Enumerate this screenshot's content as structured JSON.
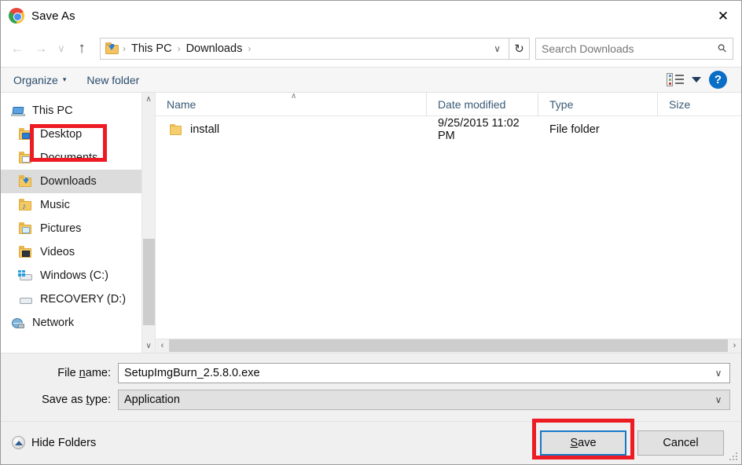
{
  "window": {
    "title": "Save As",
    "app_icon": "chrome-icon",
    "close_label": "✕"
  },
  "nav": {
    "back": "←",
    "forward": "→",
    "recent": "∨",
    "up": "↑",
    "address": {
      "folder_icon": "downloads-folder-icon",
      "crumbs": [
        "This PC",
        "Downloads"
      ],
      "separator": "›",
      "chevron": "∨"
    },
    "refresh": "↻",
    "search": {
      "placeholder": "Search Downloads",
      "value": "",
      "icon": "search-icon"
    }
  },
  "commandbar": {
    "organize": "Organize",
    "organize_caret": "▾",
    "new_folder": "New folder",
    "view_caret": "▾",
    "help": "?"
  },
  "sidebar": {
    "items": [
      {
        "label": "This PC",
        "icon": "pc-icon",
        "selected": false,
        "root": true
      },
      {
        "label": "Desktop",
        "icon": "desktop-folder-icon",
        "selected": false,
        "root": false
      },
      {
        "label": "Documents",
        "icon": "documents-folder-icon",
        "selected": false,
        "root": false
      },
      {
        "label": "Downloads",
        "icon": "downloads-folder-icon",
        "selected": true,
        "root": false
      },
      {
        "label": "Music",
        "icon": "music-folder-icon",
        "selected": false,
        "root": false
      },
      {
        "label": "Pictures",
        "icon": "pictures-folder-icon",
        "selected": false,
        "root": false
      },
      {
        "label": "Videos",
        "icon": "videos-folder-icon",
        "selected": false,
        "root": false
      },
      {
        "label": "Windows (C:)",
        "icon": "windows-drive-icon",
        "selected": false,
        "root": false
      },
      {
        "label": "RECOVERY (D:)",
        "icon": "drive-icon",
        "selected": false,
        "root": false
      },
      {
        "label": "Network",
        "icon": "network-icon",
        "selected": false,
        "root": true
      }
    ],
    "scroll_up": "∧",
    "scroll_down": "∨"
  },
  "filelist": {
    "columns": [
      "Name",
      "Date modified",
      "Type",
      "Size"
    ],
    "sort_indicator": "∧",
    "rows": [
      {
        "name": "install",
        "date_modified": "9/25/2015 11:02 PM",
        "type": "File folder",
        "size": "",
        "icon": "folder-icon"
      }
    ],
    "hscroll_left": "‹",
    "hscroll_right": "›"
  },
  "form": {
    "file_name": {
      "label_pre": "File ",
      "label_accel": "n",
      "label_post": "ame:",
      "value": "SetupImgBurn_2.5.8.0.exe",
      "chevron": "∨"
    },
    "save_as_type": {
      "label_pre": "Save as ",
      "label_accel": "t",
      "label_post": "ype:",
      "value": "Application",
      "chevron": "∨"
    }
  },
  "footer": {
    "hide_folders": "Hide Folders",
    "save_pre": "",
    "save_accel": "S",
    "save_post": "ave",
    "cancel": "Cancel"
  },
  "annotations": {
    "accent_color": "#ed1c24",
    "focus_color": "#1878c8",
    "highlighted": [
      "Desktop",
      "Save"
    ]
  }
}
